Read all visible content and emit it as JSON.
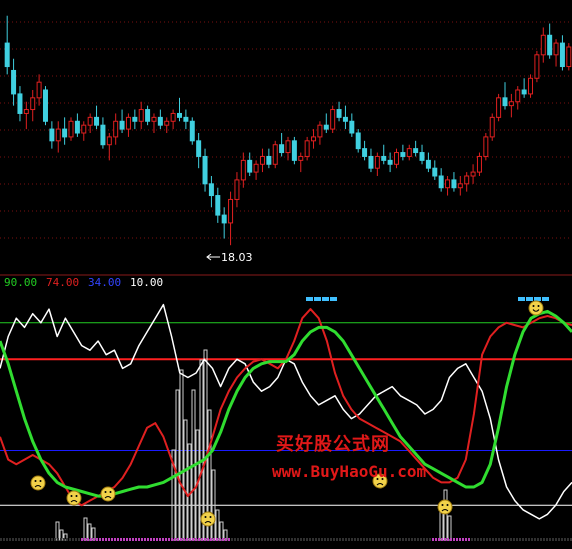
{
  "price_panel": {
    "low_marker_label": "18.03"
  },
  "indicator_header": {
    "items": [
      {
        "text": "90.00",
        "color": "#22cc22"
      },
      {
        "text": "74.00",
        "color": "#e02020"
      },
      {
        "text": "34.00",
        "color": "#3344ff"
      },
      {
        "text": "10.00",
        "color": "#ffffff"
      }
    ]
  },
  "watermark": {
    "line1": "买好股公式网",
    "line2": "www.BuyHaoGu.com"
  },
  "colors": {
    "background": "#000000",
    "up_candle": "#e02020",
    "down_candle": "#40d0e0",
    "grid": "#7a1010",
    "separator": "#8a1a1a",
    "green_line": "#30dd30",
    "red_line": "#e02020",
    "white_line": "#ffffff",
    "blue_ref": "#1a1aff",
    "signal_bars": "#40c0ff"
  },
  "chart_data": [
    {
      "type": "candlestick",
      "title": "",
      "annotations": [
        {
          "text": "18.03",
          "meaning": "period low"
        }
      ],
      "ohlc": [
        [
          23.2,
          23.9,
          22.4,
          22.6
        ],
        [
          22.5,
          22.8,
          21.6,
          21.9
        ],
        [
          21.9,
          22.1,
          21.2,
          21.4
        ],
        [
          21.4,
          21.7,
          21.0,
          21.5
        ],
        [
          21.5,
          22.0,
          21.2,
          21.8
        ],
        [
          21.8,
          22.4,
          21.6,
          22.2
        ],
        [
          22.0,
          22.1,
          21.1,
          21.2
        ],
        [
          21.0,
          21.2,
          20.5,
          20.7
        ],
        [
          20.7,
          21.2,
          20.4,
          21.0
        ],
        [
          21.0,
          21.3,
          20.6,
          20.8
        ],
        [
          20.8,
          21.3,
          20.7,
          21.2
        ],
        [
          21.2,
          21.4,
          20.8,
          20.9
        ],
        [
          20.9,
          21.2,
          20.7,
          21.1
        ],
        [
          21.1,
          21.4,
          20.9,
          21.3
        ],
        [
          21.3,
          21.6,
          21.0,
          21.1
        ],
        [
          21.1,
          21.3,
          20.5,
          20.6
        ],
        [
          20.6,
          20.9,
          20.2,
          20.8
        ],
        [
          20.8,
          21.4,
          20.6,
          21.2
        ],
        [
          21.2,
          21.5,
          20.9,
          21.0
        ],
        [
          21.0,
          21.4,
          20.8,
          21.3
        ],
        [
          21.3,
          21.5,
          21.0,
          21.2
        ],
        [
          21.2,
          21.7,
          21.0,
          21.5
        ],
        [
          21.5,
          21.6,
          21.1,
          21.2
        ],
        [
          21.2,
          21.4,
          20.9,
          21.3
        ],
        [
          21.3,
          21.5,
          21.0,
          21.1
        ],
        [
          21.1,
          21.3,
          20.9,
          21.2
        ],
        [
          21.2,
          21.5,
          21.0,
          21.4
        ],
        [
          21.4,
          21.8,
          21.2,
          21.3
        ],
        [
          21.3,
          21.5,
          21.0,
          21.2
        ],
        [
          21.2,
          21.3,
          20.6,
          20.7
        ],
        [
          20.7,
          20.9,
          20.0,
          20.3
        ],
        [
          20.3,
          20.5,
          19.4,
          19.6
        ],
        [
          19.6,
          19.8,
          19.0,
          19.3
        ],
        [
          19.3,
          19.5,
          18.6,
          18.8
        ],
        [
          18.8,
          19.0,
          18.2,
          18.6
        ],
        [
          18.6,
          19.4,
          18.03,
          19.2
        ],
        [
          19.2,
          19.9,
          19.0,
          19.7
        ],
        [
          19.7,
          20.4,
          19.5,
          20.2
        ],
        [
          20.2,
          20.4,
          19.8,
          19.9
        ],
        [
          19.9,
          20.2,
          19.7,
          20.1
        ],
        [
          20.1,
          20.5,
          19.9,
          20.3
        ],
        [
          20.3,
          20.5,
          20.0,
          20.1
        ],
        [
          20.1,
          20.7,
          20.0,
          20.6
        ],
        [
          20.6,
          20.9,
          20.3,
          20.4
        ],
        [
          20.4,
          20.8,
          20.2,
          20.7
        ],
        [
          20.7,
          20.8,
          20.1,
          20.2
        ],
        [
          20.2,
          20.4,
          19.9,
          20.3
        ],
        [
          20.3,
          20.8,
          20.2,
          20.7
        ],
        [
          20.7,
          21.0,
          20.5,
          20.8
        ],
        [
          20.8,
          21.2,
          20.6,
          21.1
        ],
        [
          21.1,
          21.4,
          20.9,
          21.0
        ],
        [
          21.0,
          21.6,
          20.9,
          21.5
        ],
        [
          21.5,
          21.7,
          21.2,
          21.3
        ],
        [
          21.3,
          21.6,
          21.0,
          21.2
        ],
        [
          21.2,
          21.4,
          20.8,
          20.9
        ],
        [
          20.9,
          21.0,
          20.4,
          20.5
        ],
        [
          20.5,
          20.7,
          20.2,
          20.3
        ],
        [
          20.3,
          20.5,
          19.9,
          20.0
        ],
        [
          20.0,
          20.4,
          19.8,
          20.3
        ],
        [
          20.3,
          20.6,
          20.1,
          20.2
        ],
        [
          20.2,
          20.4,
          19.9,
          20.1
        ],
        [
          20.1,
          20.5,
          20.0,
          20.4
        ],
        [
          20.4,
          20.6,
          20.2,
          20.3
        ],
        [
          20.3,
          20.6,
          20.2,
          20.5
        ],
        [
          20.5,
          20.7,
          20.3,
          20.4
        ],
        [
          20.4,
          20.6,
          20.1,
          20.2
        ],
        [
          20.2,
          20.4,
          19.9,
          20.0
        ],
        [
          20.0,
          20.2,
          19.7,
          19.8
        ],
        [
          19.8,
          20.0,
          19.4,
          19.5
        ],
        [
          19.5,
          19.8,
          19.3,
          19.7
        ],
        [
          19.7,
          19.9,
          19.4,
          19.5
        ],
        [
          19.5,
          19.8,
          19.3,
          19.6
        ],
        [
          19.6,
          19.9,
          19.4,
          19.8
        ],
        [
          19.8,
          20.1,
          19.6,
          19.9
        ],
        [
          19.9,
          20.4,
          19.8,
          20.3
        ],
        [
          20.3,
          20.9,
          20.2,
          20.8
        ],
        [
          20.8,
          21.4,
          20.7,
          21.3
        ],
        [
          21.3,
          21.9,
          21.2,
          21.8
        ],
        [
          21.8,
          22.2,
          21.5,
          21.6
        ],
        [
          21.6,
          21.9,
          21.3,
          21.7
        ],
        [
          21.7,
          22.1,
          21.5,
          22.0
        ],
        [
          22.0,
          22.3,
          21.8,
          21.9
        ],
        [
          21.9,
          22.4,
          21.8,
          22.3
        ],
        [
          22.3,
          23.0,
          22.2,
          22.9
        ],
        [
          22.9,
          23.6,
          22.7,
          23.4
        ],
        [
          23.4,
          23.7,
          22.8,
          22.9
        ],
        [
          22.9,
          23.3,
          22.6,
          23.2
        ],
        [
          23.2,
          23.4,
          22.5,
          22.6
        ],
        [
          22.6,
          23.2,
          22.5,
          23.1
        ]
      ]
    },
    {
      "type": "line",
      "title": "",
      "ylim": [
        0,
        100
      ],
      "reference_lines": [
        90,
        74,
        34,
        10
      ],
      "series": [
        {
          "color": "#30dd30",
          "values": [
            82,
            72,
            60,
            48,
            38,
            30,
            24,
            20,
            18,
            17,
            16,
            15,
            14,
            14,
            15,
            16,
            17,
            18,
            18,
            19,
            20,
            22,
            24,
            26,
            28,
            30,
            34,
            42,
            52,
            60,
            66,
            70,
            72,
            73,
            73,
            73,
            76,
            82,
            86,
            88,
            88,
            86,
            82,
            76,
            70,
            64,
            58,
            52,
            46,
            40,
            36,
            32,
            28,
            26,
            24,
            22,
            20,
            18,
            18,
            20,
            28,
            44,
            62,
            76,
            86,
            92,
            94,
            95,
            93,
            90,
            86
          ]
        },
        {
          "color": "#e02020",
          "values": [
            40,
            30,
            28,
            30,
            32,
            30,
            28,
            24,
            18,
            12,
            10,
            12,
            14,
            16,
            18,
            22,
            28,
            36,
            44,
            46,
            40,
            30,
            20,
            14,
            18,
            28,
            40,
            52,
            60,
            66,
            70,
            73,
            74,
            72,
            70,
            74,
            82,
            92,
            96,
            92,
            82,
            68,
            58,
            52,
            48,
            46,
            44,
            42,
            40,
            38,
            34,
            30,
            26,
            22,
            20,
            20,
            22,
            30,
            50,
            76,
            84,
            88,
            90,
            89,
            88,
            90,
            92,
            93,
            92,
            90,
            89
          ]
        },
        {
          "color": "#ffffff",
          "values": [
            70,
            84,
            92,
            88,
            94,
            90,
            96,
            84,
            92,
            86,
            80,
            78,
            82,
            76,
            78,
            70,
            72,
            80,
            86,
            92,
            98,
            84,
            68,
            66,
            68,
            74,
            70,
            62,
            70,
            74,
            72,
            64,
            60,
            62,
            66,
            74,
            72,
            64,
            58,
            54,
            56,
            58,
            52,
            48,
            50,
            54,
            58,
            60,
            62,
            58,
            56,
            54,
            50,
            52,
            56,
            66,
            70,
            72,
            66,
            60,
            48,
            30,
            18,
            12,
            8,
            6,
            4,
            6,
            10,
            16,
            20
          ]
        }
      ]
    }
  ]
}
